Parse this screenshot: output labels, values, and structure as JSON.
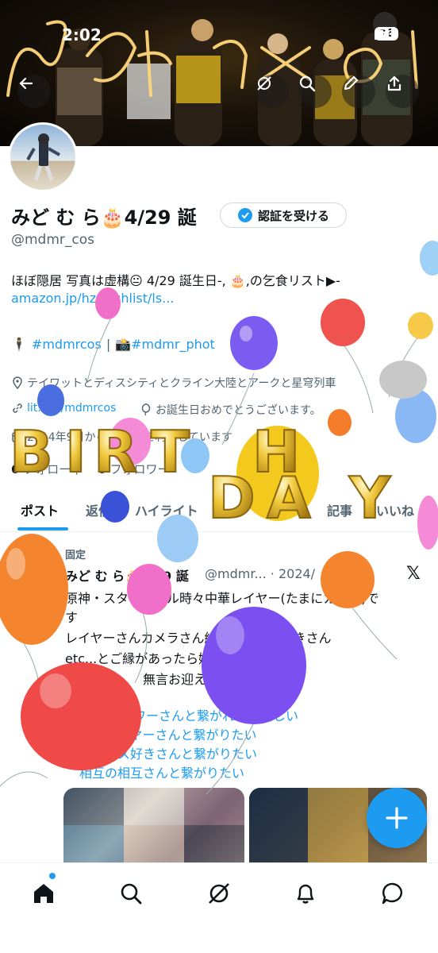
{
  "status_bar": {
    "time": "2:02",
    "battery": "76"
  },
  "banner": {
    "sparkler_text": "Nf r ol"
  },
  "profile": {
    "name": "みど む ら🎂4/29 誕",
    "verify_button": "認証を受ける",
    "handle": "@mdmr_cos",
    "bio_line1": "ほぼ隠居 写真は虚構😐 4/29 誕生日-, 🎂,の乞食リスト▶-",
    "bio_line2": "amazon.jp/hz/wishlist/ls...",
    "tag1": "#mdmrcos",
    "tag_sep": "|",
    "tag2": "📸#mdmr_phot",
    "location": "テイワットとディスシティとクライン大陸とアークと星穹列車",
    "link": "lit.link/mdmrcos",
    "birthday": "お誕生日おめでとうございます。",
    "joined": "2014年9月からTwitterを利用しています",
    "following_count": "6",
    "following_label": "フォロー中",
    "followers_count": "6",
    "followers_label": "フォロワー"
  },
  "tabs": [
    {
      "label": "ポスト"
    },
    {
      "label": "返信"
    },
    {
      "label": "ハイライト"
    },
    {
      "label": "記事"
    },
    {
      "label": "いいね"
    }
  ],
  "pinned_tweet": {
    "pinned_label": "固定",
    "name": "みど む ら🎂4/29 誕",
    "handle_date": "@mdmr... · 2024/",
    "lines": [
      "原神・スターレイル時々中華レイヤー(たまにカメラ)で",
      "す",
      "レイヤーさんカメラさん絵描きさん字書きさん",
      "etc...とご縁があったら嬉しいです✨",
      "無言お迎えすみません"
    ],
    "blue_lines": [
      "フォロワーさんと繋がれたら嬉しい",
      "原神レイヤーさんと繋がりたい",
      "中華コス好きさんと繋がりたい",
      "相互の相互さんと繋がりたい"
    ]
  },
  "overlay": {
    "birthday_word1": "BIRTH",
    "birthday_word2": "DAY"
  },
  "colors": {
    "accent": "#1d9bf0",
    "text": "#0f1419",
    "muted": "#536471",
    "balloon_gold": "#e8b923"
  },
  "icons": {
    "back": "back-arrow-icon",
    "grok": "grok-icon",
    "search": "search-icon",
    "edit": "pencil-icon",
    "share": "share-icon",
    "verified": "verified-badge-icon",
    "location": "location-pin-icon",
    "link": "link-icon",
    "birthday": "balloon-icon",
    "calendar": "calendar-icon",
    "home": "home-icon",
    "notifications": "bell-icon",
    "messages": "message-icon",
    "compose": "plus-icon"
  }
}
